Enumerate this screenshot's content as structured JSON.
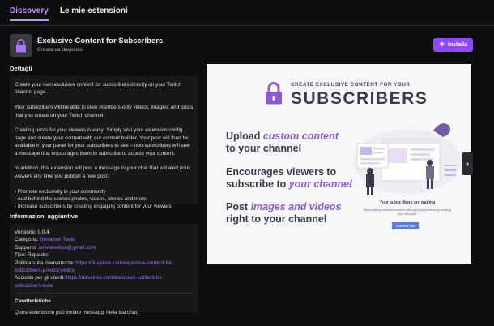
{
  "tabs": [
    {
      "label": "Discovery"
    },
    {
      "label": "Le mie estensioni"
    }
  ],
  "extension": {
    "title": "Exclusive Content for Subscribers",
    "author": "Creata da davekiss",
    "install_label": "Installa"
  },
  "details": {
    "heading": "Dettagli",
    "paragraphs": [
      "Create your own exclusive content for subscribers directly on your Twitch channel page.",
      "Your subscribers will be able to view members-only videos, images, and posts that you create on your Twitch channel.",
      "Creating posts for your viewers is easy! Simply visit your extension config page and create your content with our content builder. Your post will then be available in your panel for your subscribers to see – non-subscribers will see a message that encourages them to subscribe to access your content.",
      "In addition, this extension will post a message to your chat that will alert your viewers any time you publish a new post."
    ],
    "bullets": [
      "- Promote exclusivity in your community",
      "- Add behind the scenes photos, videos, stories and more!",
      "- Increase subscribers by creating engaging content for your viewers"
    ]
  },
  "info": {
    "heading": "Informazioni aggiuntive",
    "version_label": "Versione:",
    "version": "0.0.4",
    "category_label": "Categoria:",
    "category": "Streamer Tools",
    "support_label": "Supporto:",
    "support": "iamdavekiss@gmail.com",
    "type_label": "Tipo:",
    "type": "Riquadro",
    "privacy_label": "Politica sulla riservatezza:",
    "privacy_link_a": "https://davekiss.com/exclusive-content-for-",
    "privacy_link_b": "subscribers-privacy-policy",
    "eula_label": "Accordo per gli utenti:",
    "eula_link_a": "https://davekiss.com/exclusive-content-for-",
    "eula_link_b": "subscribers-eula",
    "features_heading": "Caratteristiche",
    "features_text": "Quest'estensione può inviare messaggi nella tua chat."
  },
  "preview": {
    "small_title": "CREATE EXCLUSIVE CONTENT FOR YOUR",
    "big_title": "SUBSCRIBERS",
    "line1_a": "Upload ",
    "line1_em": "custom content",
    "line1_b": "to your channel",
    "line2_a": "Encourages viewers to",
    "line2_b": "subscribe to ",
    "line2_em": "your channel",
    "line3_a": "Post ",
    "line3_em": "images and videos",
    "line3_b": "right to your channel",
    "waiting_title": "Your subscribers are waiting",
    "waiting_sub": "Start sharing exclusive content with your subscribers by creating your first post.",
    "add_post": "Add new post"
  },
  "colors": {
    "accent": "#9147ff",
    "link": "#a970ff",
    "background": "#0e0e10",
    "card": "#18181b"
  }
}
